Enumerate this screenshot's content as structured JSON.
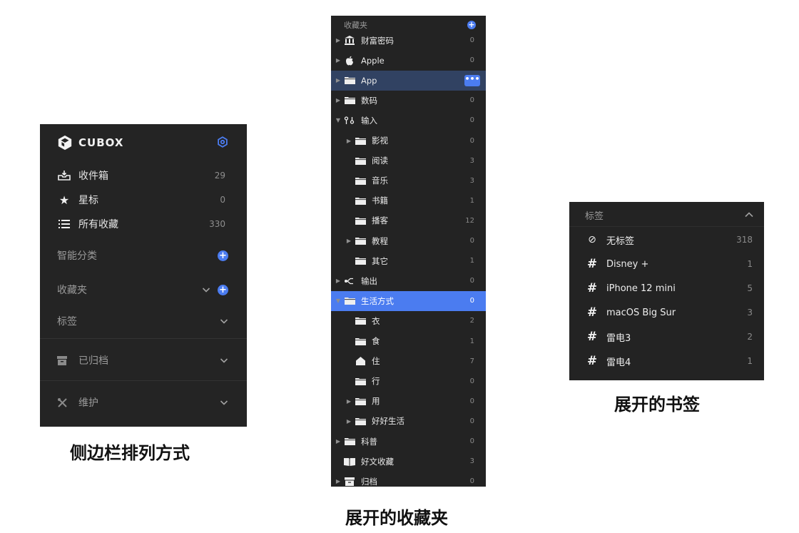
{
  "panel1": {
    "logo_text": "CUBOX",
    "items": [
      {
        "label": "收件箱",
        "count": "29",
        "icon": "inbox-icon"
      },
      {
        "label": "星标",
        "count": "0",
        "icon": "star-icon"
      },
      {
        "label": "所有收藏",
        "count": "330",
        "icon": "list-icon"
      }
    ],
    "smart": "智能分类",
    "favorites": "收藏夹",
    "tags": "标签",
    "archived": "已归档",
    "maintain": "维护",
    "accent": "#4b7cf0"
  },
  "panel2": {
    "header": "收藏夹",
    "rows": [
      {
        "label": "财富密码",
        "count": "0"
      },
      {
        "label": "Apple",
        "count": "0"
      },
      {
        "label": "App",
        "count": "•••"
      },
      {
        "label": "数码",
        "count": "0"
      },
      {
        "label": "输入",
        "count": "0"
      },
      {
        "label": "影视",
        "count": "0"
      },
      {
        "label": "阅读",
        "count": "3"
      },
      {
        "label": "音乐",
        "count": "3"
      },
      {
        "label": "书籍",
        "count": "1"
      },
      {
        "label": "播客",
        "count": "12"
      },
      {
        "label": "教程",
        "count": "0"
      },
      {
        "label": "其它",
        "count": "1"
      },
      {
        "label": "输出",
        "count": "0"
      },
      {
        "label": "生活方式",
        "count": "0"
      },
      {
        "label": "衣",
        "count": "2"
      },
      {
        "label": "食",
        "count": "1"
      },
      {
        "label": "住",
        "count": "7"
      },
      {
        "label": "行",
        "count": "0"
      },
      {
        "label": "用",
        "count": "0"
      },
      {
        "label": "好好生活",
        "count": "0"
      },
      {
        "label": "科普",
        "count": "0"
      },
      {
        "label": "好文收藏",
        "count": "3"
      },
      {
        "label": "归档",
        "count": "0"
      }
    ]
  },
  "panel3": {
    "header": "标签",
    "rows": [
      {
        "label": "无标签",
        "count": "318",
        "icon": "no-tag-icon"
      },
      {
        "label": "Disney +",
        "count": "1",
        "icon": "hash-icon"
      },
      {
        "label": "iPhone 12 mini",
        "count": "5",
        "icon": "hash-icon"
      },
      {
        "label": "macOS Big Sur",
        "count": "3",
        "icon": "hash-icon"
      },
      {
        "label": "雷电3",
        "count": "2",
        "icon": "hash-icon"
      },
      {
        "label": "雷电4",
        "count": "1",
        "icon": "hash-icon"
      }
    ]
  },
  "captions": {
    "sidebar": "侧边栏排列方式",
    "folders": "展开的收藏夹",
    "tags": "展开的书签"
  }
}
